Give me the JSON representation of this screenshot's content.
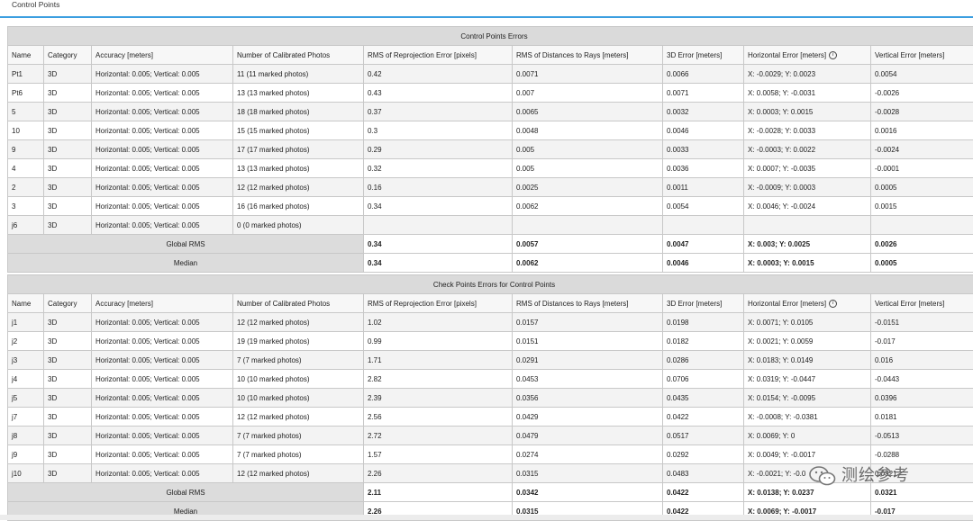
{
  "page": {
    "title": "Control Points"
  },
  "info_icon": "info-icon",
  "control_table": {
    "caption": "Control Points Errors",
    "columns": [
      "Name",
      "Category",
      "Accuracy [meters]",
      "Number of Calibrated Photos",
      "RMS of Reprojection Error [pixels]",
      "RMS of Distances to Rays [meters]",
      "3D Error [meters]",
      "Horizontal Error [meters]",
      "Vertical Error [meters]"
    ],
    "rows": [
      [
        "Pt1",
        "3D",
        "Horizontal: 0.005; Vertical: 0.005",
        "11 (11 marked photos)",
        "0.42",
        "0.0071",
        "0.0066",
        "X: -0.0029; Y: 0.0023",
        "0.0054"
      ],
      [
        "Pt6",
        "3D",
        "Horizontal: 0.005; Vertical: 0.005",
        "13 (13 marked photos)",
        "0.43",
        "0.007",
        "0.0071",
        "X: 0.0058; Y: -0.0031",
        "-0.0026"
      ],
      [
        "5",
        "3D",
        "Horizontal: 0.005; Vertical: 0.005",
        "18 (18 marked photos)",
        "0.37",
        "0.0065",
        "0.0032",
        "X: 0.0003; Y: 0.0015",
        "-0.0028"
      ],
      [
        "10",
        "3D",
        "Horizontal: 0.005; Vertical: 0.005",
        "15 (15 marked photos)",
        "0.3",
        "0.0048",
        "0.0046",
        "X: -0.0028; Y: 0.0033",
        "0.0016"
      ],
      [
        "9",
        "3D",
        "Horizontal: 0.005; Vertical: 0.005",
        "17 (17 marked photos)",
        "0.29",
        "0.005",
        "0.0033",
        "X: -0.0003; Y: 0.0022",
        "-0.0024"
      ],
      [
        "4",
        "3D",
        "Horizontal: 0.005; Vertical: 0.005",
        "13 (13 marked photos)",
        "0.32",
        "0.005",
        "0.0036",
        "X: 0.0007; Y: -0.0035",
        "-0.0001"
      ],
      [
        "2",
        "3D",
        "Horizontal: 0.005; Vertical: 0.005",
        "12 (12 marked photos)",
        "0.16",
        "0.0025",
        "0.0011",
        "X: -0.0009; Y: 0.0003",
        "0.0005"
      ],
      [
        "3",
        "3D",
        "Horizontal: 0.005; Vertical: 0.005",
        "16 (16 marked photos)",
        "0.34",
        "0.0062",
        "0.0054",
        "X: 0.0046; Y: -0.0024",
        "0.0015"
      ],
      [
        "j6",
        "3D",
        "Horizontal: 0.005; Vertical: 0.005",
        "0 (0 marked photos)",
        "",
        "",
        "",
        "",
        ""
      ]
    ],
    "summary": [
      {
        "label": "Global RMS",
        "values": [
          "0.34",
          "0.0057",
          "0.0047",
          "X: 0.003; Y: 0.0025",
          "0.0026"
        ]
      },
      {
        "label": "Median",
        "values": [
          "0.34",
          "0.0062",
          "0.0046",
          "X: 0.0003; Y: 0.0015",
          "0.0005"
        ]
      }
    ]
  },
  "check_table": {
    "caption": "Check Points Errors for Control Points",
    "columns": [
      "Name",
      "Category",
      "Accuracy [meters]",
      "Number of Calibrated Photos",
      "RMS of Reprojection Error [pixels]",
      "RMS of Distances to Rays [meters]",
      "3D Error [meters]",
      "Horizontal Error [meters]",
      "Vertical Error [meters]"
    ],
    "rows": [
      [
        "j1",
        "3D",
        "Horizontal: 0.005; Vertical: 0.005",
        "12 (12 marked photos)",
        "1.02",
        "0.0157",
        "0.0198",
        "X: 0.0071; Y: 0.0105",
        "-0.0151"
      ],
      [
        "j2",
        "3D",
        "Horizontal: 0.005; Vertical: 0.005",
        "19 (19 marked photos)",
        "0.99",
        "0.0151",
        "0.0182",
        "X: 0.0021; Y: 0.0059",
        "-0.017"
      ],
      [
        "j3",
        "3D",
        "Horizontal: 0.005; Vertical: 0.005",
        "7 (7 marked photos)",
        "1.71",
        "0.0291",
        "0.0286",
        "X: 0.0183; Y: 0.0149",
        "0.016"
      ],
      [
        "j4",
        "3D",
        "Horizontal: 0.005; Vertical: 0.005",
        "10 (10 marked photos)",
        "2.82",
        "0.0453",
        "0.0706",
        "X: 0.0319; Y: -0.0447",
        "-0.0443"
      ],
      [
        "j5",
        "3D",
        "Horizontal: 0.005; Vertical: 0.005",
        "10 (10 marked photos)",
        "2.39",
        "0.0356",
        "0.0435",
        "X: 0.0154; Y: -0.0095",
        "0.0396"
      ],
      [
        "j7",
        "3D",
        "Horizontal: 0.005; Vertical: 0.005",
        "12 (12 marked photos)",
        "2.56",
        "0.0429",
        "0.0422",
        "X: -0.0008; Y: -0.0381",
        "0.0181"
      ],
      [
        "j8",
        "3D",
        "Horizontal: 0.005; Vertical: 0.005",
        "7 (7 marked photos)",
        "2.72",
        "0.0479",
        "0.0517",
        "X: 0.0069; Y: 0",
        "-0.0513"
      ],
      [
        "j9",
        "3D",
        "Horizontal: 0.005; Vertical: 0.005",
        "7 (7 marked photos)",
        "1.57",
        "0.0274",
        "0.0292",
        "X: 0.0049; Y: -0.0017",
        "-0.0288"
      ],
      [
        "j10",
        "3D",
        "Horizontal: 0.005; Vertical: 0.005",
        "12 (12 marked photos)",
        "2.26",
        "0.0315",
        "0.0483",
        "X: -0.0021; Y: -0.0",
        "0.0321"
      ]
    ],
    "summary": [
      {
        "label": "Global RMS",
        "values": [
          "2.11",
          "0.0342",
          "0.0422",
          "X: 0.0138; Y: 0.0237",
          "0.0321"
        ]
      },
      {
        "label": "Median",
        "values": [
          "2.26",
          "0.0315",
          "0.0422",
          "X: 0.0069; Y: -0.0017",
          "-0.017"
        ]
      }
    ]
  },
  "watermark": {
    "text": "测绘参考",
    "icon": "wechat-icon"
  }
}
